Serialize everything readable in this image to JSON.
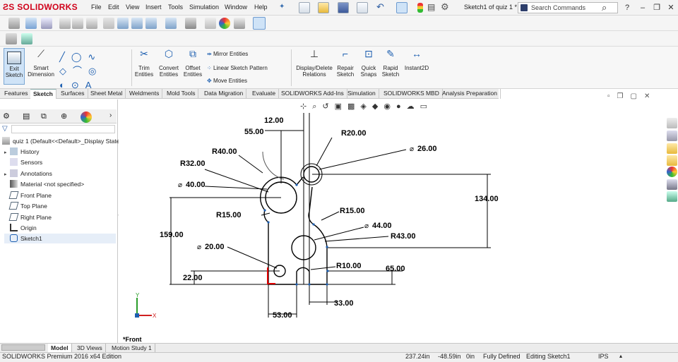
{
  "app": {
    "brand": "SOLIDWORKS",
    "menu": [
      "File",
      "Edit",
      "View",
      "Insert",
      "Tools",
      "Simulation",
      "Window",
      "Help"
    ],
    "document_title": "Sketch1 of quiz 1 *",
    "search_placeholder": "Search Commands"
  },
  "command_manager": {
    "exit_sketch": "Exit Sketch",
    "smart_dimension": "Smart Dimension",
    "trim_entities": "Trim Entities",
    "convert_entities": "Convert Entities",
    "offset_entities": "Offset Entities",
    "mirror_entities": "Mirror Entities",
    "linear_sketch_pattern": "Linear Sketch Pattern",
    "move_entities": "Move Entities",
    "display_delete_relations": "Display/Delete Relations",
    "repair_sketch": "Repair Sketch",
    "quick_snaps": "Quick Snaps",
    "rapid_sketch": "Rapid Sketch",
    "instant2d": "Instant2D"
  },
  "tabs": [
    "Features",
    "Sketch",
    "Surfaces",
    "Sheet Metal",
    "Weldments",
    "Mold Tools",
    "Data Migration",
    "Evaluate",
    "SOLIDWORKS Add-Ins",
    "Simulation",
    "SOLIDWORKS MBD",
    "Analysis Preparation"
  ],
  "feature_tree": {
    "root": "quiz 1  (Default<<Default>_Display State",
    "items": [
      "History",
      "Sensors",
      "Annotations",
      "Material <not specified>",
      "Front Plane",
      "Top Plane",
      "Right Plane",
      "Origin",
      "Sketch1"
    ]
  },
  "drawing": {
    "dims": [
      "12.00",
      "55.00",
      "R20.00",
      "R40.00",
      "26.00",
      "R32.00",
      "40.00",
      "134.00",
      "R15.00",
      "R15.00",
      "44.00",
      "159.00",
      "R43.00",
      "20.00",
      "R10.00",
      "65.00",
      "22.00",
      "33.00",
      "53.00"
    ],
    "view_label": "*Front",
    "triad_x": "X",
    "triad_y": "Y"
  },
  "bottom_tabs": [
    "Model",
    "3D Views",
    "Motion Study 1"
  ],
  "status": {
    "edition": "SOLIDWORKS Premium 2016 x64 Edition",
    "x": "237.24in",
    "y": "-48.59in",
    "z": "0in",
    "state": "Fully Defined",
    "editing": "Editing Sketch1",
    "units": "IPS"
  }
}
